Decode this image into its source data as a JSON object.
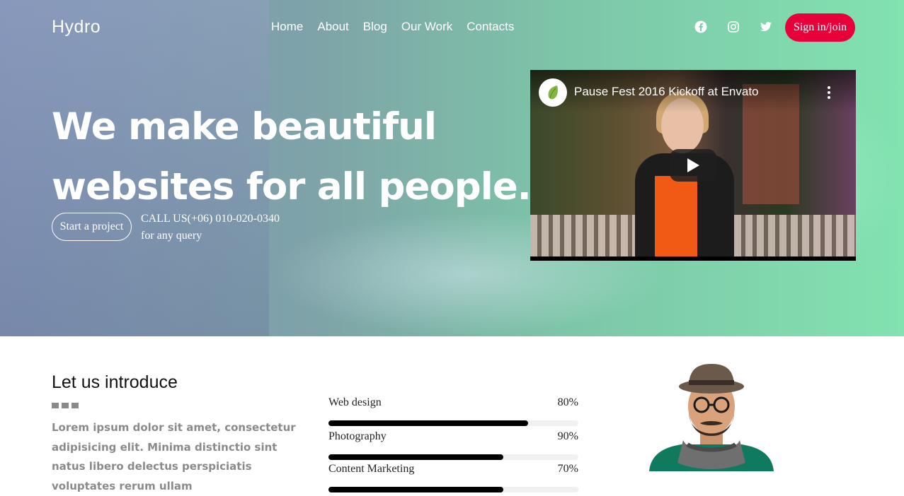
{
  "header": {
    "logo": "Hydro",
    "nav": [
      "Home",
      "About",
      "Blog",
      "Our Work",
      "Contacts"
    ],
    "social_icons": [
      "facebook-icon",
      "instagram-icon",
      "twitter-icon"
    ],
    "signin_label": "Sign in/join",
    "signin_color": "#e8003a"
  },
  "hero": {
    "headline_line1": "We make beautiful",
    "headline_line2": "websites for all people.",
    "cta_label": "Start a project",
    "call_line1": "CALL US(+06) 010-020-0340",
    "call_line2": "for any query"
  },
  "video": {
    "title": "Pause Fest 2016 Kickoff at Envato",
    "channel_icon": "envato-leaf-icon",
    "play_icon": "play-icon",
    "menu_icon": "more-vertical-icon"
  },
  "intro": {
    "title": "Let us introduce",
    "text": "Lorem ipsum dolor sit amet, consectetur adipisicing elit. Minima distinctio sint natus libero delectus perspiciatis voluptates rerum ullam"
  },
  "skills": [
    {
      "label": "Web design",
      "percent_text": "80%",
      "value": 0.8
    },
    {
      "label": "Photography",
      "percent_text": "90%",
      "value": 0.7
    },
    {
      "label": "Content Marketing",
      "percent_text": "70%",
      "value": 0.7
    }
  ]
}
